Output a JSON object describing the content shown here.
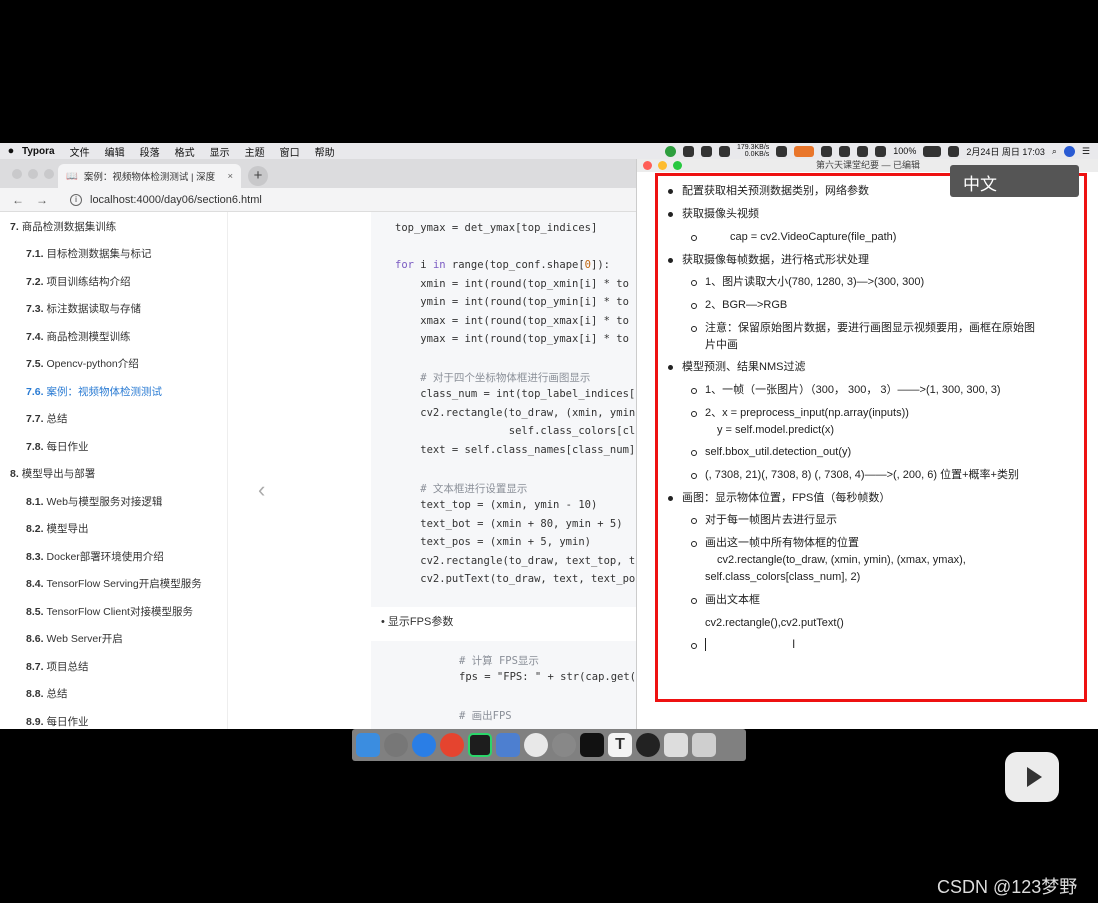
{
  "menubar": {
    "apple": "",
    "items": [
      "Typora",
      "文件",
      "编辑",
      "段落",
      "格式",
      "显示",
      "主题",
      "窗口",
      "帮助"
    ],
    "net_up": "179.3KB/s",
    "net_down": "0.0KB/s",
    "battery": "100%",
    "datetime": "2月24日 周日 17:03"
  },
  "browser": {
    "tab_title": "案例：视频物体检测测试 | 深度",
    "tab_close": "×",
    "new_tab": "+",
    "back": "←",
    "forward": "→",
    "url": "localhost:4000/day06/section6.html",
    "sidebar": [
      {
        "num": "7.",
        "label": "商品检测数据集训练"
      },
      {
        "num": "7.1.",
        "label": "目标检测数据集与标记"
      },
      {
        "num": "7.2.",
        "label": "项目训练结构介绍"
      },
      {
        "num": "7.3.",
        "label": "标注数据读取与存储"
      },
      {
        "num": "7.4.",
        "label": "商品检测模型训练"
      },
      {
        "num": "7.5.",
        "label": "Opencv-python介绍"
      },
      {
        "num": "7.6.",
        "label": "案例：视频物体检测测试"
      },
      {
        "num": "7.7.",
        "label": "总结"
      },
      {
        "num": "7.8.",
        "label": "每日作业"
      },
      {
        "num": "8.",
        "label": "模型导出与部署"
      },
      {
        "num": "8.1.",
        "label": "Web与模型服务对接逻辑"
      },
      {
        "num": "8.2.",
        "label": "模型导出"
      },
      {
        "num": "8.3.",
        "label": "Docker部署环境使用介绍"
      },
      {
        "num": "8.4.",
        "label": "TensorFlow Serving开启模型服务"
      },
      {
        "num": "8.5.",
        "label": "TensorFlow Client对接模型服务"
      },
      {
        "num": "8.6.",
        "label": "Web Server开启"
      },
      {
        "num": "8.7.",
        "label": "项目总结"
      },
      {
        "num": "8.8.",
        "label": "总结"
      },
      {
        "num": "8.9.",
        "label": "每日作业"
      }
    ],
    "prev_chevron": "‹",
    "code_top": "top_ymax = det_ymax[top_indices]",
    "code_for": "for i in range(top_conf.shape[0]):",
    "code_xmin": "    xmin = int(round(top_xmin[i] * to",
    "code_ymin": "    ymin = int(round(top_ymin[i] * to",
    "code_xmax": "    xmax = int(round(top_xmax[i] * to",
    "code_ymax": "    ymax = int(round(top_ymax[i] * to",
    "code_c1": "    # 对于四个坐标物体框进行画图显示",
    "code_cls": "    class_num = int(top_label_indices[",
    "code_rect1": "    cv2.rectangle(to_draw, (xmin, ymin",
    "code_rect2": "                  self.class_colors[cl",
    "code_text": "    text = self.class_names[class_num]",
    "code_c2": "    # 文本框进行设置显示",
    "code_ttop": "    text_top = (xmin, ymin - 10)",
    "code_tbot": "    text_bot = (xmin + 80, ymin + 5)",
    "code_tpos": "    text_pos = (xmin + 5, ymin)",
    "code_rect3": "    cv2.rectangle(to_draw, text_top, t",
    "code_put": "    cv2.putText(to_draw, text, text_po",
    "bullet_fps": "显示FPS参数",
    "code_c3": "# 计算 FPS显示",
    "code_fps": "fps = \"FPS: \" + str(cap.get(",
    "code_c4": "# 画出FPS"
  },
  "typora": {
    "window_title": "第六天课堂纪要 — 已编辑",
    "ime_badge": "中文",
    "l1": "配置获取相关预测数据类别，网络参数",
    "l2": "获取摄像头视频",
    "l3": "cap = cv2.VideoCapture(file_path)",
    "l4": "获取摄像每帧数据，进行格式形状处理",
    "l5": "1、图片读取大小(780, 1280, 3)—>(300, 300)",
    "l6": "2、BGR—>RGB",
    "l7a": "注意：保留原始图片数据，要进行画图显示视频要用，画框在原始图",
    "l7b": "片中画",
    "l8": "模型预测、结果NMS过滤",
    "l9": "1、一帧（一张图片）（300，  300，  3）——>(1, 300, 300, 3)",
    "l10a": "2、x = preprocess_input(np.array(inputs))",
    "l10b": "y = self.model.predict(x)",
    "l11": "self.bbox_util.detection_out(y)",
    "l12": "(, 7308, 21)(, 7308, 8) (, 7308, 4)——>(, 200, 6) 位置+概率+类别",
    "l13": "画图：显示物体位置，FPS值（每秒帧数）",
    "l14": "对于每一帧图片去进行显示",
    "l15a": "画出这一帧中所有物体框的位置",
    "l15b": "cv2.rectangle(to_draw, (xmin, ymin), (xmax, ymax),",
    "l15c": "self.class_colors[class_num], 2)",
    "l16": "画出文本框",
    "l17": "cv2.rectangle(),cv2.putText()",
    "ibeam": "I"
  },
  "dock": [
    "finder-icon",
    "launchpad-icon",
    "safari-icon",
    "chrome-icon",
    "pycharm-icon",
    "keynote-icon",
    "vivaldi-icon",
    "preferences-icon",
    "terminal-icon",
    "typora-icon",
    "obs-icon",
    "screenshot-icon",
    "trash-icon"
  ],
  "watermark": "CSDN @123梦野",
  "colors": {
    "highlight_box": "#e11111",
    "active_link": "#2a7bd3",
    "ime_badge_bg": "#555555"
  }
}
